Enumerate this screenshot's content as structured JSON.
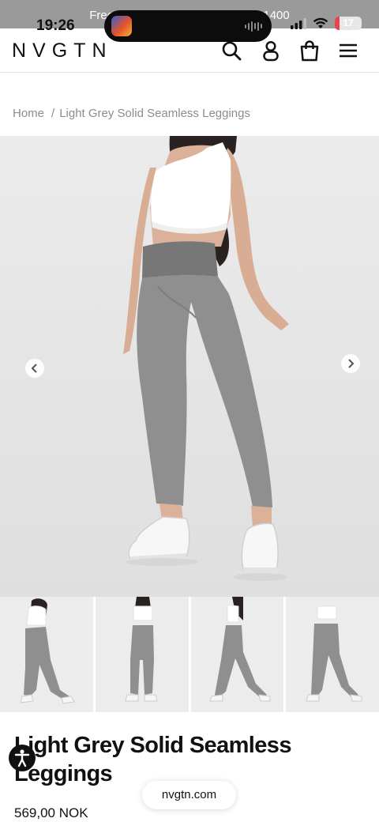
{
  "status_bar": {
    "time": "19:26",
    "promo_text": "Free shipping on orders above kr1400",
    "battery_level": "17",
    "battery_fraction": 0.17,
    "battery_color": "#e8434f"
  },
  "header": {
    "logo": "NVGTN",
    "icons": [
      "search-icon",
      "account-icon",
      "shopping-bag-icon",
      "menu-icon"
    ]
  },
  "breadcrumb": {
    "home": "Home",
    "separator": "/",
    "current": "Light Grey Solid Seamless Leggings"
  },
  "gallery": {
    "main_image": "product-photo-front",
    "thumbnails": [
      "thumbnail-back",
      "thumbnail-front",
      "thumbnail-side",
      "thumbnail-front-alt"
    ],
    "colors": {
      "background": "#e9e9ea",
      "leggings": "#8f8f8f",
      "top": "#ffffff"
    }
  },
  "product": {
    "title": "Light Grey Solid Seamless Leggings",
    "price": "569,00 NOK"
  },
  "browser": {
    "url": "nvgtn.com"
  },
  "accessibility": {
    "icon": "accessibility-icon"
  }
}
